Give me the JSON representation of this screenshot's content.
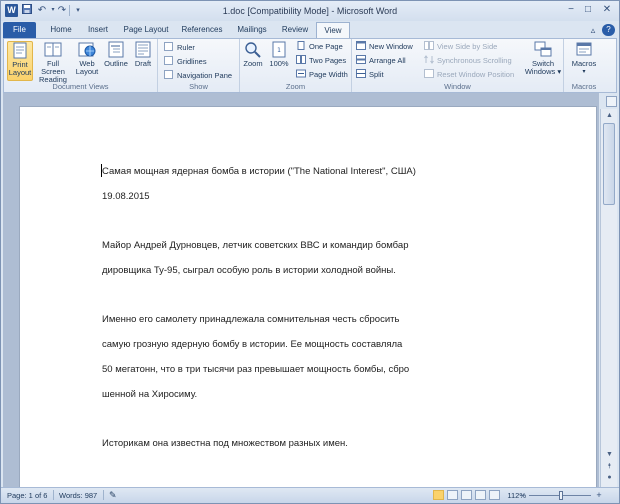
{
  "window": {
    "title": "1.doc [Compatibility Mode] - Microsoft Word",
    "app_icon_letter": "W",
    "quick_access": [
      "save-icon",
      "undo-icon",
      "redo-icon",
      "customize-icon"
    ],
    "controls": {
      "minimize": "−",
      "restore": "□",
      "close": "✕"
    }
  },
  "tabs": [
    "File",
    "Home",
    "Insert",
    "Page Layout",
    "References",
    "Mailings",
    "Review",
    "View"
  ],
  "active_tab": "View",
  "ribbon": {
    "document_views": {
      "label": "Document Views",
      "items": [
        {
          "label": "Print Layout",
          "selected": true
        },
        {
          "label": "Full Screen Reading"
        },
        {
          "label": "Web Layout"
        },
        {
          "label": "Outline"
        },
        {
          "label": "Draft"
        }
      ]
    },
    "show": {
      "label": "Show",
      "items": [
        "Ruler",
        "Gridlines",
        "Navigation Pane"
      ]
    },
    "zoom": {
      "label": "Zoom",
      "big": [
        "Zoom",
        "100%"
      ],
      "small": [
        "One Page",
        "Two Pages",
        "Page Width"
      ]
    },
    "window_group": {
      "label": "Window",
      "small": [
        "New Window",
        "Arrange All",
        "Split"
      ],
      "disabled": [
        "View Side by Side",
        "Synchronous Scrolling",
        "Reset Window Position"
      ],
      "switch": "Switch Windows"
    },
    "macros": {
      "label": "Macros",
      "button": "Macros"
    }
  },
  "document": {
    "lines": [
      "Самая мощная ядерная бомба в истории (\"The National Interest\", США)",
      "19.08.2015",
      "Майор Андрей Дурновцев, летчик советских ВВС и командир бомбар",
      "дировщика Ту-95, сыграл особую роль в истории холодной войны.",
      "Именно его самолету принадлежала сомнительная честь сбросить",
      "самую грозную ядерную бомбу в истории. Ее мощность составляла",
      "50 мегатонн, что в три тысячи раз превышает мощность бомбы, сбро",
      "шенной на Хиросиму.",
      "Историкам она известна под множеством разных имен."
    ]
  },
  "status": {
    "page": "Page: 1 of 6",
    "words": "Words: 987",
    "zoom": "112%",
    "zoom_minus": "−",
    "zoom_plus": "+"
  },
  "colors": {
    "file_tab": "#2a5da8",
    "selected": "#fbd26b"
  }
}
